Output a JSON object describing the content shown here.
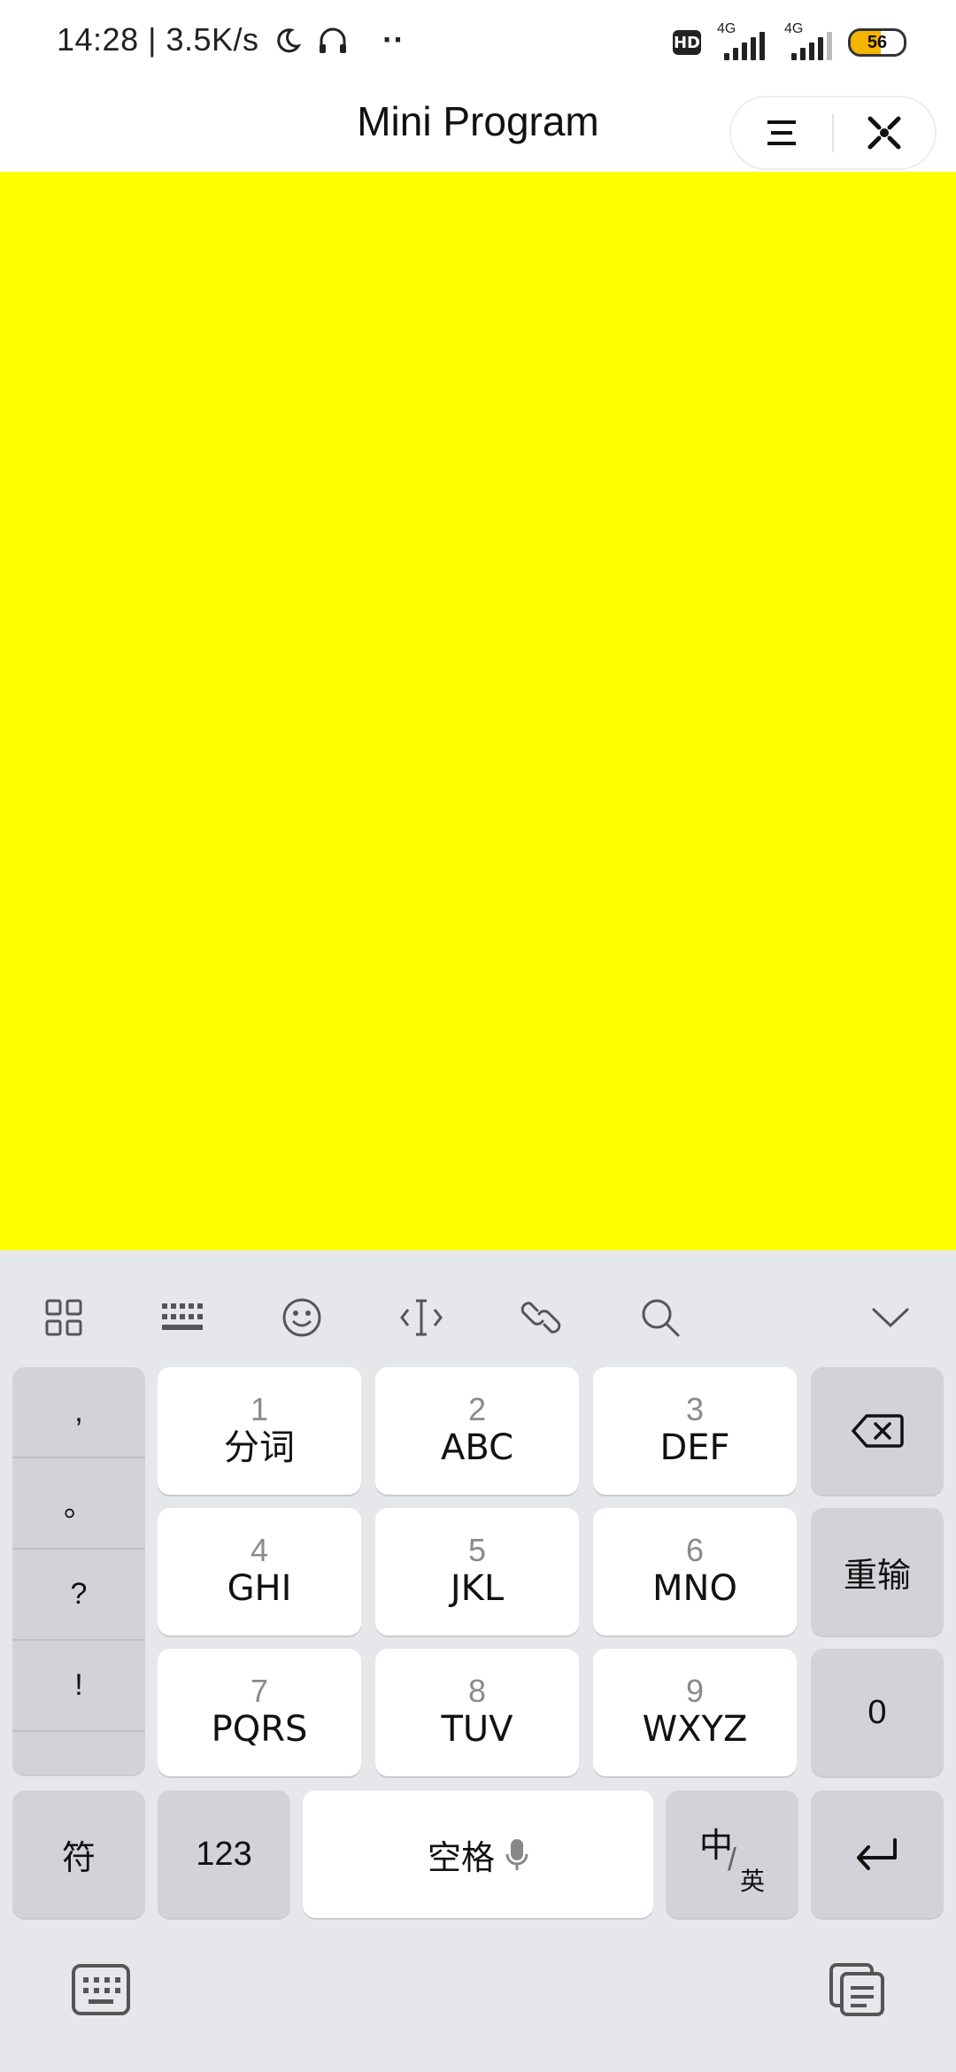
{
  "status_bar": {
    "text": "14:28 | 3.5K/s",
    "hd_badge": "HD",
    "signal1_label": "4G",
    "signal2_label": "4G",
    "battery": "56",
    "battery_level": 56
  },
  "header": {
    "title": "Mini Program",
    "menu_icon": "menu-icon",
    "close_icon": "close-icon"
  },
  "content": {
    "background": "#ffff00"
  },
  "keyboard": {
    "toolbar_icons": [
      "grid-icon",
      "keyboard-layout-icon",
      "emoji-icon",
      "cursor-icon",
      "link-icon",
      "search-icon",
      "collapse-chevron-icon"
    ],
    "punctuation": [
      ",",
      "。",
      "?",
      "!"
    ],
    "keys": [
      {
        "num": "1",
        "letters": "分词"
      },
      {
        "num": "2",
        "letters": "ABC"
      },
      {
        "num": "3",
        "letters": "DEF"
      },
      {
        "num": "4",
        "letters": "GHI"
      },
      {
        "num": "5",
        "letters": "JKL"
      },
      {
        "num": "6",
        "letters": "MNO"
      },
      {
        "num": "7",
        "letters": "PQRS"
      },
      {
        "num": "8",
        "letters": "TUV"
      },
      {
        "num": "9",
        "letters": "WXYZ"
      }
    ],
    "reenter": "重输",
    "zero": "0",
    "symbols": "符",
    "numbers": "123",
    "space": "空格",
    "lang_main": "中",
    "lang_sub": "英"
  }
}
